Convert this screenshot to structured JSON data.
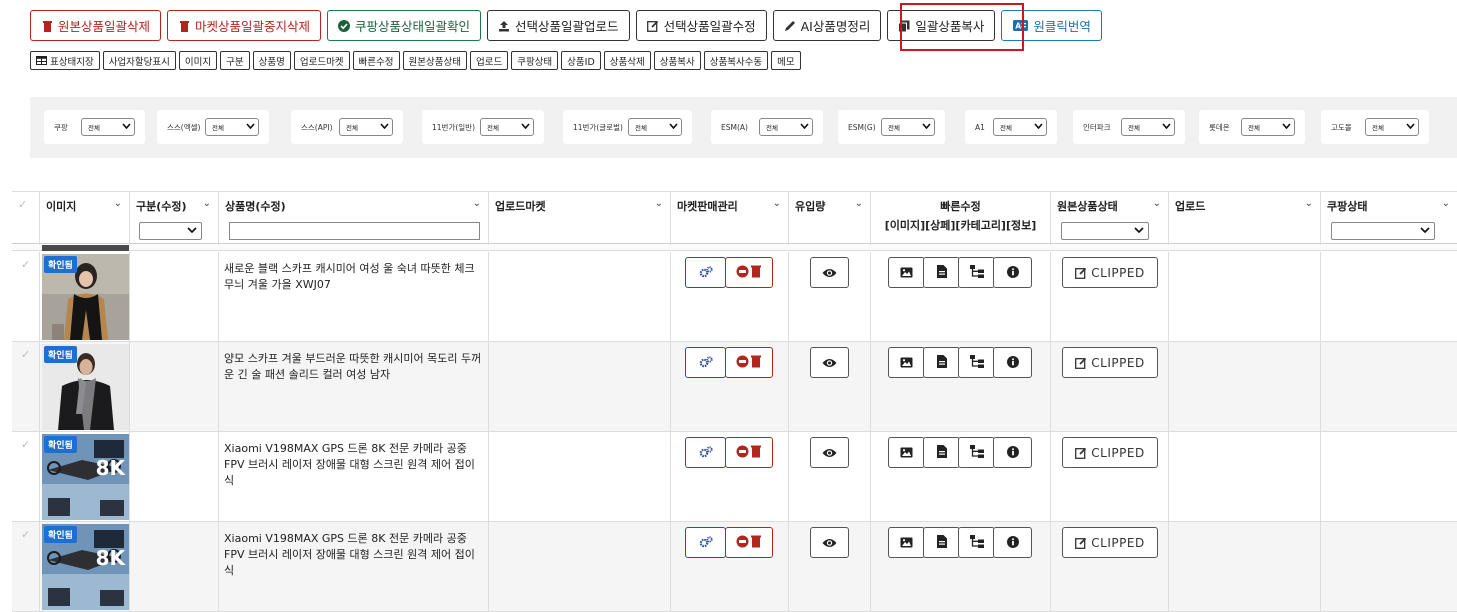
{
  "actions": [
    {
      "label": "원본상품일괄삭제",
      "style": "red",
      "icon": "trash-icon"
    },
    {
      "label": "마켓상품일괄중지삭제",
      "style": "red",
      "icon": "trash-icon"
    },
    {
      "label": "쿠팡상품상태일괄확인",
      "style": "green",
      "icon": "check-circle-icon"
    },
    {
      "label": "선택상품일괄업로드",
      "style": "dark",
      "icon": "upload-icon"
    },
    {
      "label": "선택상품일괄수정",
      "style": "dark",
      "icon": "edit-icon"
    },
    {
      "label": "AI상품명정리",
      "style": "dark",
      "icon": "pencil-icon"
    },
    {
      "label": "일괄상품복사",
      "style": "dark",
      "icon": "copy-icon"
    },
    {
      "label": "원클릭번역",
      "style": "blue",
      "icon": "translate-icon"
    }
  ],
  "toggles": [
    "표상태지장",
    "사업자할당표시",
    "이미지",
    "구분",
    "상품명",
    "업로드마켓",
    "빠른수정",
    "원본상품상태",
    "업로드",
    "쿠팡상태",
    "상품ID",
    "상품삭제",
    "상품복사",
    "상품복사수동",
    "메모"
  ],
  "filters": [
    {
      "label": "쿠팡",
      "value": "전체"
    },
    {
      "label": "스스(엑셀)",
      "value": "전체"
    },
    {
      "label": "스스(API)",
      "value": "전체"
    },
    {
      "label": "11번가(일반)",
      "value": "전체"
    },
    {
      "label": "11번가(글로벌)",
      "value": "전체"
    },
    {
      "label": "ESM(A)",
      "value": "전체"
    },
    {
      "label": "ESM(G)",
      "value": "전체"
    },
    {
      "label": "A1",
      "value": "전체"
    },
    {
      "label": "인터파크",
      "value": "전체"
    },
    {
      "label": "롯데온",
      "value": "전체"
    },
    {
      "label": "고도몰",
      "value": "전체"
    }
  ],
  "columns": {
    "check": "✓",
    "image": "이미지",
    "category": "구분(수정)",
    "name": "상품명(수정)",
    "market": "업로드마켓",
    "sales": "마켓판매관리",
    "traffic": "유입량",
    "quick": "빠른수정",
    "quick_sub": "[이미지][상페][카테고리][정보]",
    "source": "원본상품상태",
    "upload": "업로드",
    "coupang": "쿠팡상태"
  },
  "chevron": "⌄",
  "rows": [
    {
      "badge": "확인됨",
      "name": "새로운 블랙 스카프 캐시미어 여성 울 숙녀 따뜻한 체크 무늬 겨울 가을 XWJ07",
      "status": "CLIPPED",
      "thumb": "scarf"
    },
    {
      "badge": "확인됨",
      "name": "양모 스카프 겨울 부드러운 따뜻한 캐시미어 목도리 두꺼운 긴 술 패션 솔리드 컬러 여성 남자",
      "status": "CLIPPED",
      "thumb": "suit"
    },
    {
      "badge": "확인됨",
      "name": "Xiaomi V198MAX GPS 드론 8K 전문 카메라 공중 FPV 브러시 레이저 장애물 대형 스크린 원격 제어 접이식",
      "status": "CLIPPED",
      "thumb": "drone"
    },
    {
      "badge": "확인됨",
      "name": "Xiaomi V198MAX GPS 드론 8K 전문 카메라 공중 FPV 브러시 레이저 장애물 대형 스크린 원격 제어 접이식",
      "status": "CLIPPED",
      "thumb": "drone"
    }
  ],
  "drone_tag": "8K",
  "colors": {
    "red": "#b3261e",
    "green": "#1e7a4a",
    "blue": "#1f7ab8",
    "highlight": "#d0161b",
    "badge": "#1f6fd0"
  }
}
